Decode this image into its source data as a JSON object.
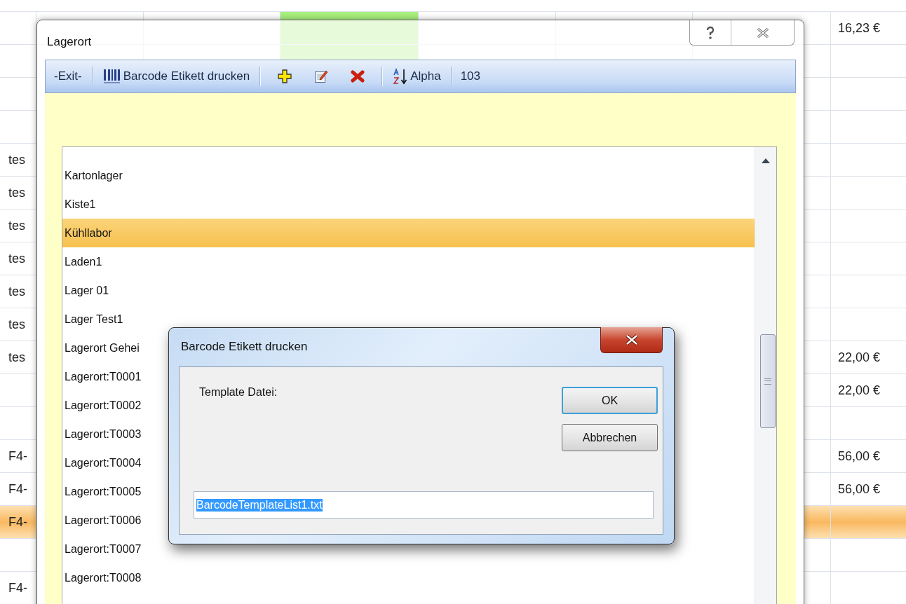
{
  "sheet": {
    "rows": [
      {
        "last": "16,23 €",
        "selected": false,
        "highlighted": true
      },
      {
        "selected": false,
        "highlighted": true
      },
      {
        "selected": false
      },
      {
        "selected": false
      },
      {
        "first": "tes",
        "selected": false
      },
      {
        "first": "tes",
        "selected": false
      },
      {
        "first": "tes",
        "selected": false
      },
      {
        "first": "tes",
        "selected": false
      },
      {
        "first": "tes",
        "selected": false
      },
      {
        "first": "tes",
        "selected": false
      },
      {
        "first": "tes",
        "last": "22,00 €",
        "selected": false
      },
      {
        "last": "22,00 €",
        "selected": false
      },
      {
        "selected": false
      },
      {
        "first": "F4-",
        "last": "56,00 €",
        "selected": false
      },
      {
        "first": "F4-",
        "last": "56,00 €",
        "selected": false
      },
      {
        "first": "F4-",
        "selected": true
      },
      {
        "selected": false
      },
      {
        "first": "F4-",
        "selected": false
      }
    ]
  },
  "window": {
    "title": "Lagerort",
    "toolbar": [
      {
        "kind": "text",
        "label": "-Exit-"
      },
      {
        "kind": "barcode",
        "label": "Barcode Etikett drucken"
      },
      {
        "kind": "add"
      },
      {
        "kind": "edit"
      },
      {
        "kind": "delete"
      },
      {
        "kind": "sort",
        "label": "Alpha"
      },
      {
        "kind": "count",
        "label": "103"
      }
    ],
    "list": [
      {
        "label": "Kartonlager",
        "selected": false
      },
      {
        "label": "Kiste1",
        "selected": false
      },
      {
        "label": "Kühllabor",
        "selected": true
      },
      {
        "label": "Laden1",
        "selected": false
      },
      {
        "label": "Lager 01",
        "selected": false
      },
      {
        "label": "Lager Test1",
        "selected": false
      },
      {
        "label": "Lagerort Gehei",
        "selected": false
      },
      {
        "label": "Lagerort:T0001",
        "selected": false
      },
      {
        "label": "Lagerort:T0002",
        "selected": false
      },
      {
        "label": "Lagerort:T0003",
        "selected": false
      },
      {
        "label": "Lagerort:T0004",
        "selected": false
      },
      {
        "label": "Lagerort:T0005",
        "selected": false
      },
      {
        "label": "Lagerort:T0006",
        "selected": false
      },
      {
        "label": "Lagerort:T0007",
        "selected": false
      },
      {
        "label": "Lagerort:T0008",
        "selected": false
      }
    ]
  },
  "dialog": {
    "title": "Barcode Etikett drucken",
    "label": "Template Datei:",
    "buttons": [
      {
        "label": "OK",
        "focused": true
      },
      {
        "label": "Abbrechen",
        "focused": false
      }
    ],
    "field": {
      "value": "BarcodeTemplateList1.txt",
      "text_selected": true
    }
  }
}
